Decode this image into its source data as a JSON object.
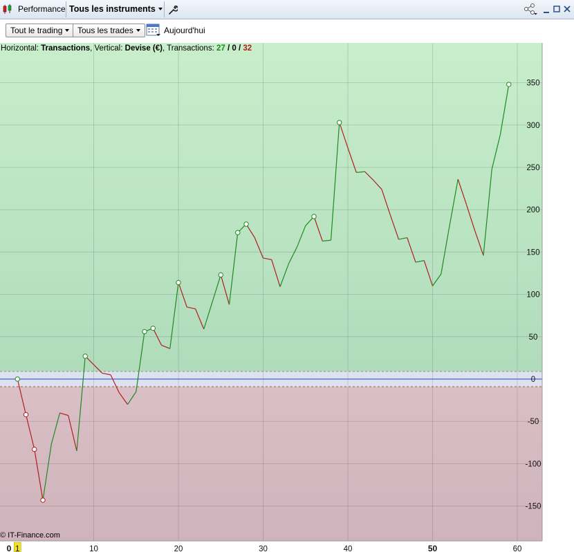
{
  "titlebar": {
    "tab_label": "Performance",
    "instruments_label": "Tous les instruments"
  },
  "toolbar": {
    "trading_filter": "Tout le trading",
    "trades_filter": "Tous les trades",
    "date_label": "Aujourd'hui"
  },
  "info": {
    "horizontal_prefix": "Horizontal:",
    "horizontal_value": "Transactions",
    "vertical_prefix": ", Vertical:",
    "vertical_value": "Devise (€)",
    "transactions_prefix": ", Transactions:",
    "winners": "27",
    "sep1": " / ",
    "neutral": "0",
    "sep2": " / ",
    "losers": "32"
  },
  "watermark": "© IT-Finance.com",
  "colors": {
    "gain_segment": "#1e8a1e",
    "loss_segment": "#b31d1d",
    "winners_text": "#1e8a1e",
    "losers_text": "#b31d1d",
    "positive_zone": "#c8eecb",
    "negative_zone": "#d8bcc3",
    "zero_line": "#2b3cc9"
  },
  "chart_data": {
    "type": "line",
    "title": "",
    "xlabel": "Transactions",
    "ylabel": "Devise (€)",
    "xlim": [
      0,
      63
    ],
    "ylim": [
      -190,
      395
    ],
    "x_ticks": [
      0,
      1,
      10,
      20,
      30,
      40,
      50,
      60
    ],
    "x_tick_labels": [
      "0",
      "1",
      "10",
      "20",
      "30",
      "40",
      "50",
      "60"
    ],
    "x_bold_ticks": [
      0,
      50
    ],
    "y_ticks": [
      350,
      300,
      250,
      200,
      150,
      100,
      50,
      0,
      -50,
      -100,
      -150
    ],
    "y_tick_labels": [
      "350",
      "300",
      "250",
      "200",
      "150",
      "100",
      "50",
      "0",
      "-50",
      "-100",
      "-150"
    ],
    "band": [
      -9,
      9
    ],
    "grid": true,
    "series": [
      {
        "x": [
          1,
          2,
          3,
          4,
          5,
          6,
          7,
          8,
          9,
          10,
          11,
          12,
          13,
          14,
          15,
          16,
          17,
          18,
          19,
          20,
          21,
          22,
          23,
          24,
          25,
          26,
          27,
          28,
          29,
          30,
          31,
          32,
          33,
          34,
          35,
          36,
          37,
          38,
          39,
          40,
          41,
          42,
          43,
          44,
          45,
          46,
          47,
          48,
          49,
          50,
          51,
          52,
          53,
          54,
          55,
          56,
          57,
          58,
          59
        ],
        "y": [
          0,
          -42,
          -83,
          -143,
          -77,
          -40,
          -43,
          -85,
          27,
          17,
          7,
          5,
          -16,
          -30,
          -15,
          56,
          60,
          40,
          36,
          114,
          85,
          83,
          59,
          91,
          123,
          88,
          173,
          183,
          167,
          143,
          141,
          109,
          136,
          156,
          181,
          192,
          163,
          164,
          303,
          273,
          244,
          245,
          235,
          224,
          194,
          165,
          167,
          138,
          140,
          110,
          124,
          181,
          236,
          206,
          175,
          146,
          248,
          289,
          348
        ]
      }
    ],
    "markers": [
      {
        "x": 1,
        "y": 0,
        "kind": "gain"
      },
      {
        "x": 2,
        "y": -42,
        "kind": "loss"
      },
      {
        "x": 3,
        "y": -83,
        "kind": "loss"
      },
      {
        "x": 4,
        "y": -143,
        "kind": "loss"
      },
      {
        "x": 9,
        "y": 27,
        "kind": "gain"
      },
      {
        "x": 16,
        "y": 56,
        "kind": "gain"
      },
      {
        "x": 17,
        "y": 60,
        "kind": "gain"
      },
      {
        "x": 20,
        "y": 114,
        "kind": "gain"
      },
      {
        "x": 25,
        "y": 123,
        "kind": "gain"
      },
      {
        "x": 27,
        "y": 173,
        "kind": "gain"
      },
      {
        "x": 28,
        "y": 183,
        "kind": "gain"
      },
      {
        "x": 36,
        "y": 192,
        "kind": "gain"
      },
      {
        "x": 39,
        "y": 303,
        "kind": "gain"
      },
      {
        "x": 59,
        "y": 348,
        "kind": "gain"
      }
    ]
  }
}
